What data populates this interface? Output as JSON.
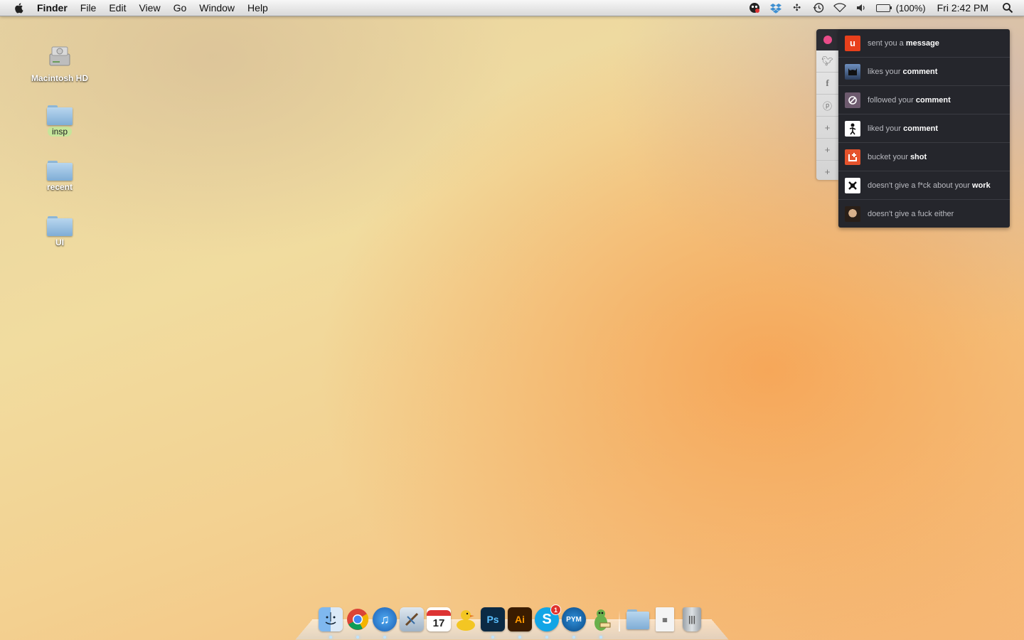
{
  "menubar": {
    "app": "Finder",
    "items": [
      "File",
      "Edit",
      "View",
      "Go",
      "Window",
      "Help"
    ],
    "battery": "(100%)",
    "clock": "Fri 2:42 PM"
  },
  "desktop": {
    "icons": [
      {
        "label": "Macintosh HD",
        "type": "drive"
      },
      {
        "label": "insp",
        "type": "folder",
        "tag": "green"
      },
      {
        "label": "recent",
        "type": "folder"
      },
      {
        "label": "UI",
        "type": "folder"
      }
    ]
  },
  "notifications": {
    "items": [
      {
        "text": "sent you a",
        "object": "message",
        "avatar": "u-logo",
        "color": "#e8401c"
      },
      {
        "text": "likes your",
        "object": "comment",
        "avatar": "batman-avatar",
        "color": "#4a6c9b"
      },
      {
        "text": "followed your",
        "object": "comment",
        "avatar": "slash-avatar",
        "color": "#6d5a6e"
      },
      {
        "text": "liked your",
        "object": "comment",
        "avatar": "figure-avatar",
        "color": "#ffffff"
      },
      {
        "text": "bucket your",
        "object": "shot",
        "avatar": "bucket-avatar",
        "color": "#e5532c"
      },
      {
        "text": "doesn't give a f*ck about your",
        "object": "work",
        "avatar": "skull-avatar",
        "color": "#ffffff"
      },
      {
        "text": "doesn't give a fuck either",
        "object": "",
        "avatar": "photo-avatar",
        "color": "#3a2e24"
      }
    ]
  },
  "dock": {
    "items": [
      {
        "name": "Finder",
        "icon": "finder-icon"
      },
      {
        "name": "Chrome",
        "icon": "chrome-icon"
      },
      {
        "name": "iTunes",
        "icon": "itunes-icon"
      },
      {
        "name": "Preview",
        "icon": "preview-icon"
      },
      {
        "name": "Calendar",
        "icon": "calendar-icon",
        "text": "17"
      },
      {
        "name": "Cyberduck",
        "icon": "duck-icon"
      },
      {
        "name": "Photoshop",
        "icon": "photoshop-icon",
        "text": "Ps"
      },
      {
        "name": "Illustrator",
        "icon": "illustrator-icon",
        "text": "Ai"
      },
      {
        "name": "Skype",
        "icon": "skype-icon",
        "text": "S",
        "badge": "1"
      },
      {
        "name": "PYM",
        "icon": "pym-icon",
        "text": "PYM"
      },
      {
        "name": "Adium",
        "icon": "adium-icon"
      }
    ]
  }
}
